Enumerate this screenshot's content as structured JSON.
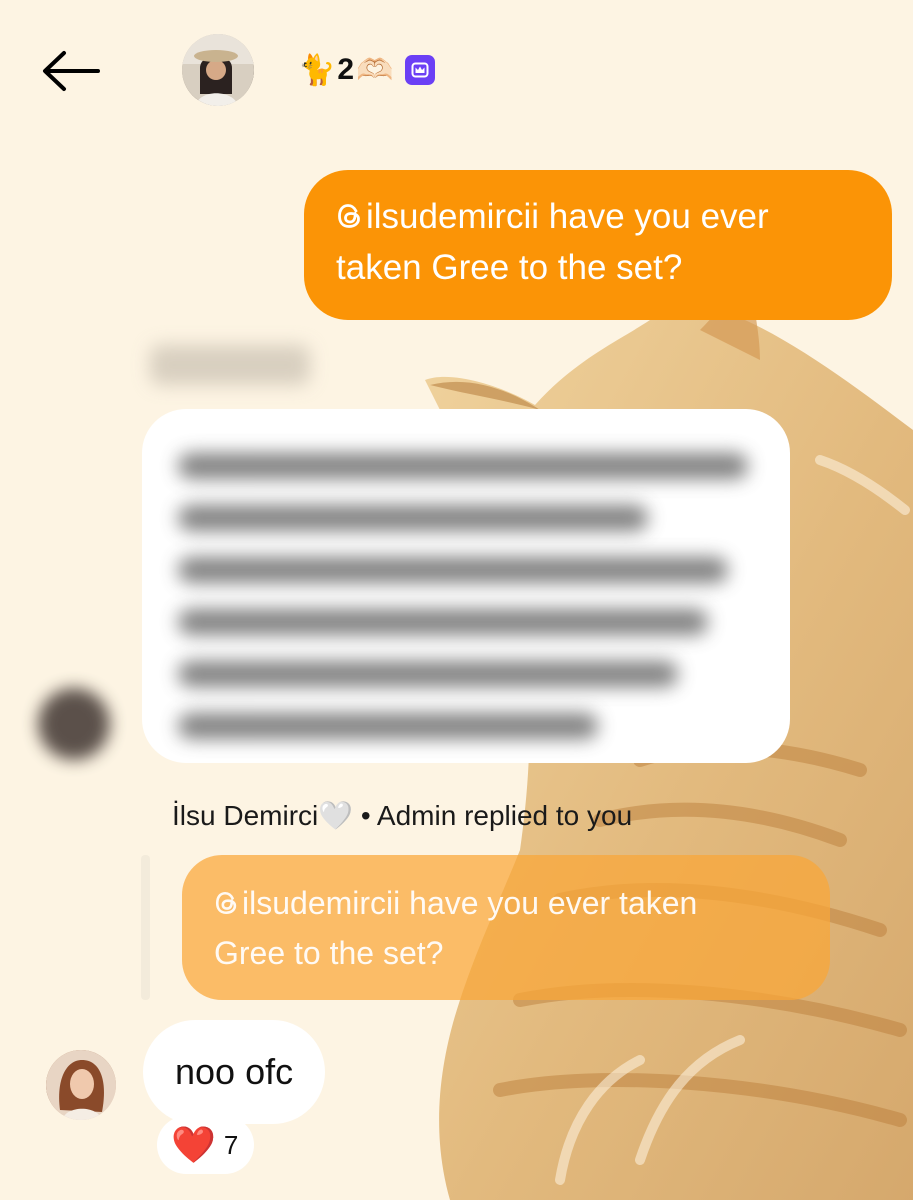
{
  "header": {
    "back_icon": "arrow-left-icon",
    "title_emoji_left": "🐈",
    "title_count": "2",
    "title_emoji_right": "🫶🏻",
    "badge_icon": "crown-icon",
    "badge_color": "#6b3ff5"
  },
  "messages": {
    "outgoing": {
      "mention_icon": "threads-icon",
      "line1": "ilsudemircii have you ever",
      "line2": "taken Gree to the set?",
      "bubble_color": "#fb9406"
    },
    "reply_context": {
      "name": "İlsu Demirci🤍",
      "suffix": "• Admin replied to you"
    },
    "quoted": {
      "mention_icon": "threads-icon",
      "line1": "ilsudemircii have you ever taken",
      "line2": "Gree to the set?"
    },
    "reply": {
      "text": "noo ofc",
      "reaction_emoji": "❤️",
      "reaction_count": "7"
    }
  }
}
